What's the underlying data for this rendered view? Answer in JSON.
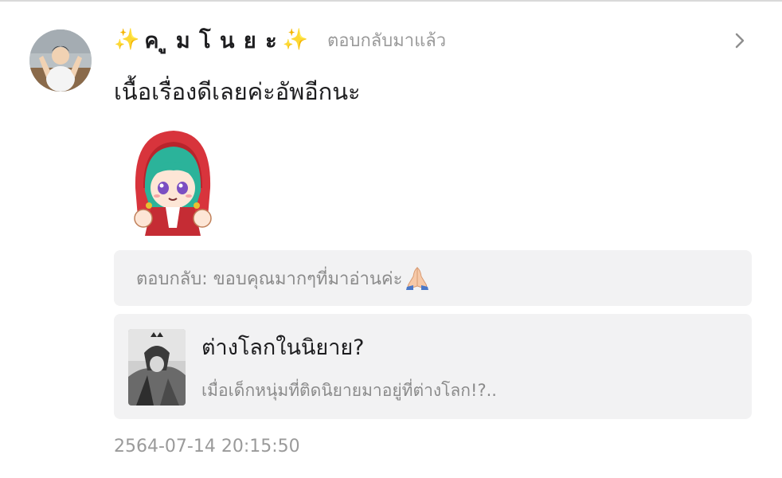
{
  "comment": {
    "username": "คูมโนยะ",
    "username_spaced": "ค ู ม โ น ย ะ",
    "sparkle_left": "✨",
    "sparkle_right": "✨",
    "reply_status": "ตอบกลับมาแล้ว",
    "text": "เนื้อเรื่องดีเลยค่ะอัพอีกนะ",
    "timestamp": "2564-07-14 20:15:50"
  },
  "reply": {
    "text": "ตอบกลับ: ขอบคุณมากๆที่มาอ่านค่ะ"
  },
  "novel": {
    "title": "ต่างโลกในนิยาย?",
    "description": "เมื่อเด็กหนุ่มที่ติดนิยายมาอยู่ที่ต่างโลก!?.."
  },
  "icons": {
    "chevron": "chevron-right-icon",
    "pray": "pray-hands-icon",
    "sparkle": "sparkles-icon"
  },
  "colors": {
    "text_primary": "#1d1d1f",
    "text_secondary": "#9a9a9a",
    "panel_bg": "#f2f2f3",
    "sparkle": "#f5b800"
  }
}
